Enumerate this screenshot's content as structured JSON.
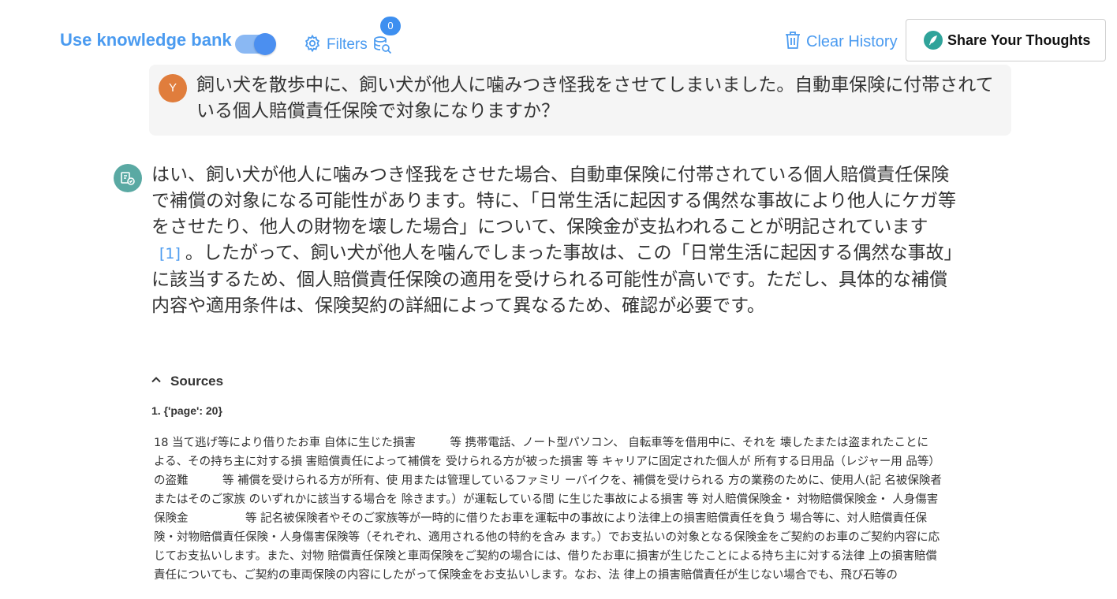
{
  "header": {
    "knowledge_bank_label": "Use knowledge bank",
    "knowledge_bank_enabled": true,
    "filters_label": "Filters",
    "filters_count": "0",
    "clear_history_label": "Clear History",
    "share_label": "Share Your Thoughts"
  },
  "user_message": {
    "avatar_initial": "Y",
    "text": "飼い犬を散歩中に、飼い犬が他人に噛みつき怪我をさせてしまいました。自動車保険に付帯されている個人賠償責任保険で対象になりますか？"
  },
  "assistant_message": {
    "answer_part1": "はい、飼い犬が他人に噛みつき怪我をさせた場合、自動車保険に付帯されている個人賠償責任保険で補償の対象になる可能性があります。特に、「日常生活に起因する偶然な事故により他人にケガ等をさせたり、他人の財物を壊した場合」について、保険金が支払われることが明記されています",
    "citation": "[1]",
    "answer_part2": "。したがって、飼い犬が他人を噛んでしまった事故は、この「日常生活に起因する偶然な事故」に該当するため、個人賠償責任保険の適用を受けられる可能性が高いです。ただし、具体的な補償内容や適用条件は、保険契約の詳細によって異なるため、確認が必要です。",
    "sources_label": "Sources",
    "sources": [
      {
        "title": "1. {'page': 20}",
        "text": "18 当て逃げ等により借りたお車 自体に生じた損害　　　等 携帯電話、ノート型パソコン、 自転車等を借用中に、それを 壊したまたは盗まれたことに よる、その持ち主に対する損 害賠償責任によって補償を 受けられる方が被った損害 等 キャリアに固定された個人が 所有する日用品（レジャー用 品等）の盗難　　　等 補償を受けられる方が所有、使 用または管理しているファミリ ーバイクを、補償を受けられる 方の業務のために、使用人(記 名被保険者またはそのご家族 のいずれかに該当する場合を 除きます。）が運転している間 に生じた事故による損害 等 対人賠償保険金・ 対物賠償保険金・ 人身傷害保険金　　　　　等 記名被保険者やそのご家族等が一時的に借りたお車を運転中の事故により法律上の損害賠償責任を負う 場合等に、対人賠償責任保険・対物賠償責任保険・人身傷害保険等（それぞれ、適用される他の特約を含み ます。）でお支払いの対象となる保険金をご契約のお車のご契約内容に応じてお支払いします。また、対物 賠償責任保険と車両保険をご契約の場合には、借りたお車に損害が生じたことによる持ち主に対する法律 上の損害賠償責任についても、ご契約の車両保険の内容にしたがって保険金をお支払いします。なお、法 律上の損害賠償責任が生じない場合でも、飛び石等の"
      }
    ]
  },
  "colors": {
    "accent": "#4b9bf0",
    "user_avatar": "#e07d3c",
    "bot_avatar": "#5aa9a3",
    "share_icon": "#2fa39a"
  }
}
